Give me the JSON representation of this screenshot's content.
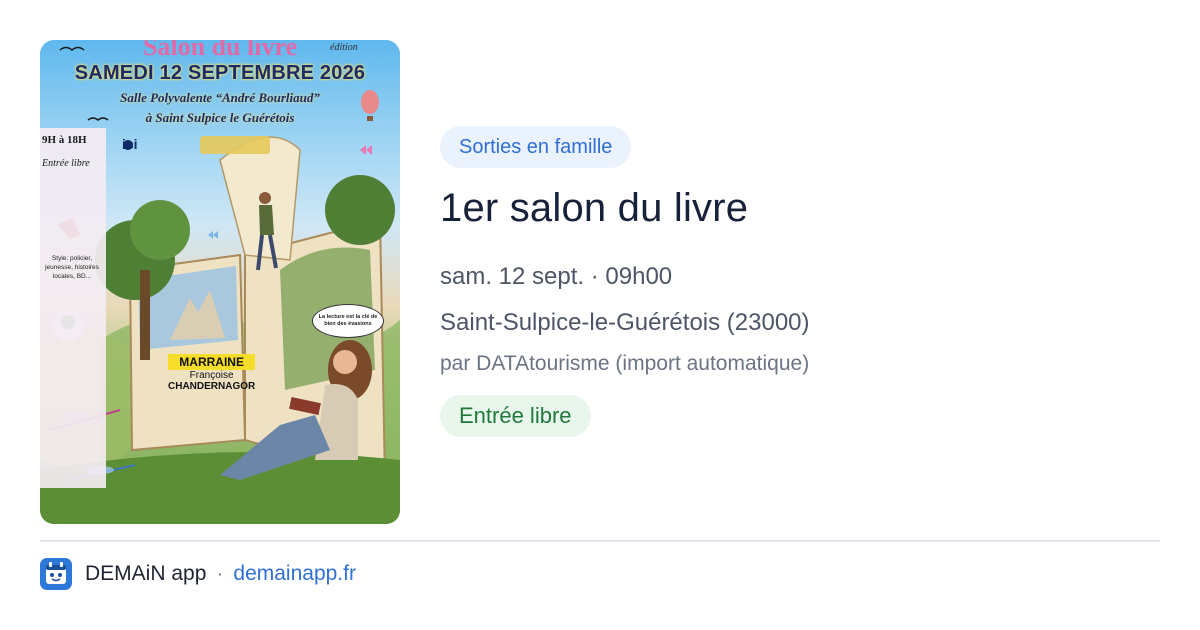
{
  "poster": {
    "salon_text": "Salon du livre",
    "edition_text": "édition",
    "date_text": "SAMEDI 12 SEPTEMBRE 2026",
    "salle_text": "Salle Polyvalente “André Bourliaud”",
    "lieu_text": "à Saint Sulpice le Guérétois",
    "hours_text": "9H à 18H",
    "entree_text": "Entrée libre",
    "ici_text": "ici",
    "style_text": "Style: policier, jeunesse, histoires locales, BD...",
    "marraine_label": "MARRAINE",
    "marraine_first": "Françoise",
    "marraine_last": "CHANDERNAGOR",
    "bubble_text": "La lecture est la clé de bien des évasions"
  },
  "event": {
    "category": "Sorties en famille",
    "title": "1er salon du livre",
    "datetime": "sam. 12 sept. · 09h00",
    "location": "Saint-Sulpice-le-Guérétois (23000)",
    "source": "par DATAtourisme (import automatique)",
    "price": "Entrée libre"
  },
  "footer": {
    "app_icon": "demain-app-icon",
    "app_name": "DEMAiN app",
    "separator": "·",
    "domain": "demainapp.fr"
  },
  "colors": {
    "accent_blue": "#2f6fd6",
    "tag_bg": "#eaf2fd",
    "price_green": "#217a3c",
    "price_bg": "#e8f6ec",
    "app_icon_bg": "#2c78d9"
  }
}
